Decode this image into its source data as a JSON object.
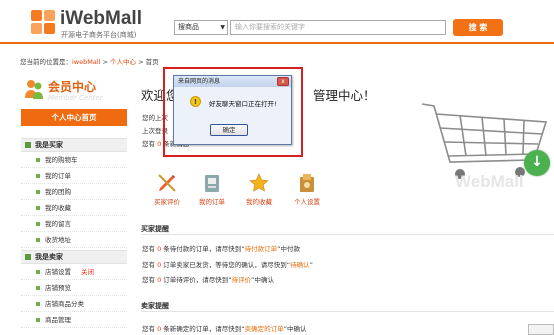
{
  "header": {
    "logo_name": "iWebMall",
    "logo_sub": "开源电子商务平台(商城)",
    "search_select": "搜商品",
    "search_placeholder": "输入你要搜索的关键字",
    "search_button": "搜  索"
  },
  "breadcrumb": {
    "prefix": "您当前的位置是：",
    "home": "iwebMall",
    "sep1": " > ",
    "center": "个人中心",
    "sep2": " > ",
    "current": "首页"
  },
  "sidebar": {
    "title_cn": "会员中心",
    "title_en": "Member Center",
    "home": "个人中心首页",
    "buyer_group": "我是买家",
    "buyer_items": [
      "我的购物车",
      "我的订单",
      "我的团购",
      "我的收藏",
      "我的留言",
      "收货地址"
    ],
    "seller_group": "我是卖家",
    "seller_items": [
      "店铺设置",
      "店铺预览",
      "店铺商品分类",
      "商品管理"
    ],
    "shop_settings_status": "关闭"
  },
  "main": {
    "welcome_left": "欢迎您",
    "welcome_right": "管理中心！",
    "stats": [
      {
        "pre": "您的上次",
        "hl": "",
        "post": ""
      },
      {
        "pre": "上次登录",
        "hl": "",
        "post": ""
      },
      {
        "pre": "您有 ",
        "hl": "0",
        "post": " 条新消息"
      }
    ],
    "quick": [
      {
        "label": "买家评价",
        "icon": "pencil-icon"
      },
      {
        "label": "我的订单",
        "icon": "order-icon"
      },
      {
        "label": "我的收藏",
        "icon": "star-icon"
      },
      {
        "label": "个人设置",
        "icon": "settings-icon"
      }
    ],
    "buyer_title": "买家提醒",
    "buyer_rows": [
      {
        "a": "您有 ",
        "n": "0",
        "b": " 条待付款的订单，请尽快到“",
        "lk": "待付款订单",
        "c": "”中付款"
      },
      {
        "a": "您有 ",
        "n": "0",
        "b": " 订单卖家已发货，等待您的确认，请尽快到“",
        "lk": "待确认",
        "c": "”"
      },
      {
        "a": "您有 ",
        "n": "0",
        "b": " 订单待评价，请尽快到“",
        "lk": "待评价",
        "c": "”中确认"
      }
    ],
    "seller_title": "卖家提醒",
    "seller_rows": [
      {
        "a": "您有 ",
        "n": "0",
        "b": " 条新确定的订单，请尽快到“",
        "lk": "卖确定的订单",
        "c": "”中确认"
      }
    ],
    "watermark": "WebMall"
  },
  "dialog": {
    "title": "来自网页的消息",
    "message": "好友聊天窗口正在打开!",
    "ok": "确定",
    "close": "x"
  },
  "colors": {
    "accent": "#f06a10",
    "link": "#e4450e",
    "highlight": "#e32222",
    "dialog_border": "#d62020"
  }
}
